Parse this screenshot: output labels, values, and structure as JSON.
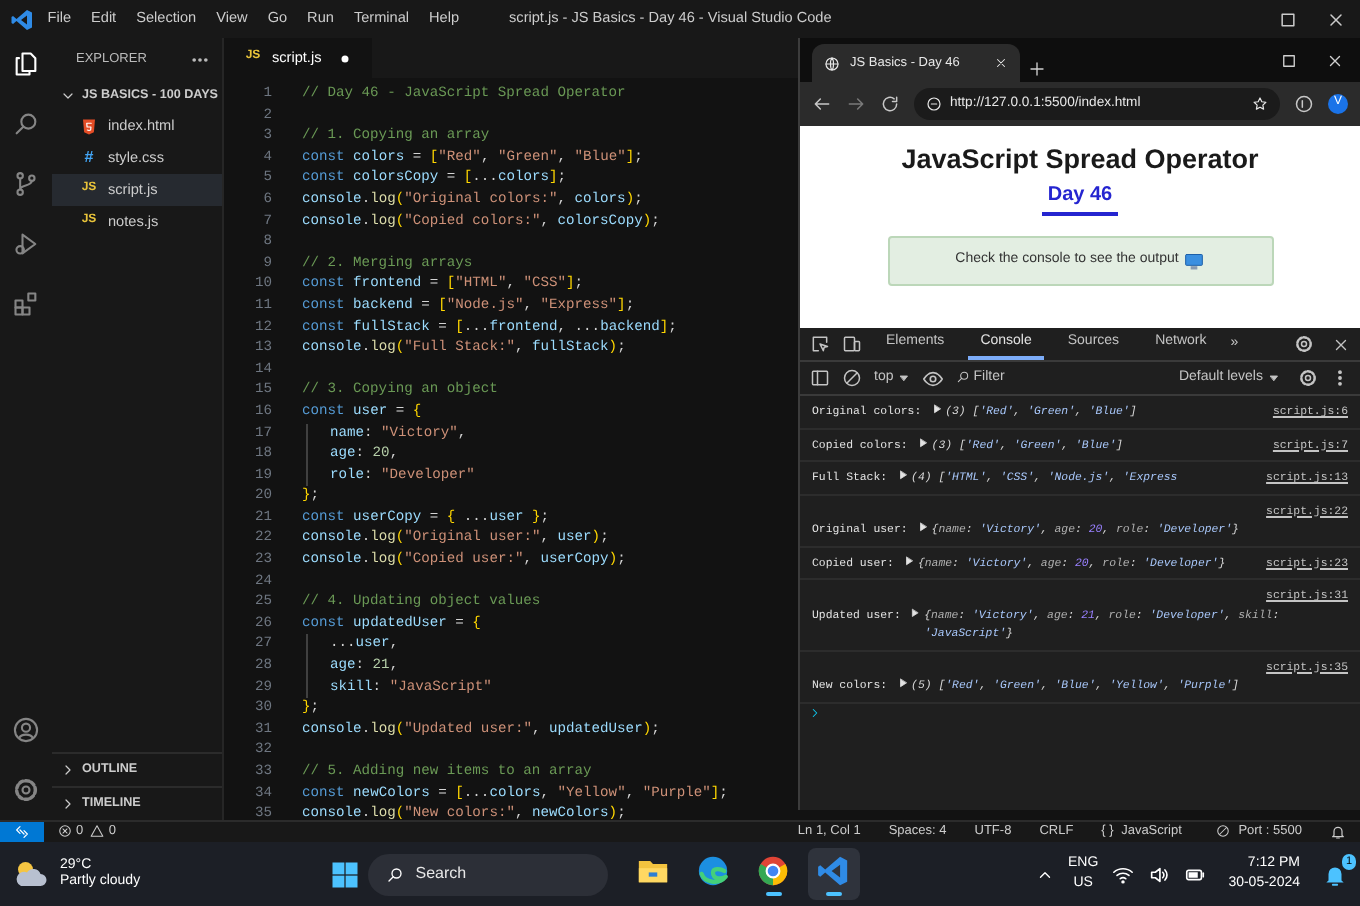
{
  "title_bar": {
    "menu": [
      "File",
      "Edit",
      "Selection",
      "View",
      "Go",
      "Run",
      "Terminal",
      "Help"
    ],
    "title": "script.js - JS Basics - Day 46 - Visual Studio Code"
  },
  "activity_bar": [
    {
      "kind": "files",
      "selected": true
    },
    {
      "kind": "search",
      "selected": false
    },
    {
      "kind": "source-control",
      "selected": false
    },
    {
      "kind": "run",
      "selected": false
    },
    {
      "kind": "extensions",
      "selected": false
    }
  ],
  "sidebar": {
    "header": "EXPLORER",
    "folder": {
      "name": "JS BASICS - 100 DAYS",
      "expanded": true,
      "files": [
        {
          "name": "index.html",
          "kind": "html",
          "selected": false
        },
        {
          "name": "style.css",
          "kind": "css",
          "icon": "#",
          "selected": false
        },
        {
          "name": "script.js",
          "kind": "js",
          "icon": "JS",
          "selected": true
        },
        {
          "name": "notes.js",
          "kind": "js",
          "icon": "JS",
          "selected": false
        }
      ]
    },
    "sections": [
      {
        "name": "OUTLINE",
        "expanded": false
      },
      {
        "name": "TIMELINE",
        "expanded": false
      }
    ]
  },
  "editor": {
    "tabs": [
      {
        "name": "script.js",
        "icon": "JS",
        "selected": true,
        "modified": true
      }
    ],
    "lines": [
      {
        "number": "1",
        "tokens": [
          {
            "kind": "comment",
            "text": "// Day 46 - JavaScript Spread Operator"
          }
        ]
      },
      {
        "number": "2"
      },
      {
        "number": "3",
        "tokens": [
          {
            "kind": "comment",
            "text": "// 1. Copying an array"
          }
        ]
      },
      {
        "number": "4",
        "tokens": [
          {
            "kind": "keyword",
            "text": "const"
          },
          {
            "kind": "variable",
            "text": " colors"
          },
          {
            "kind": "punct",
            "text": " = "
          },
          {
            "kind": "bracket",
            "text": "["
          },
          {
            "kind": "string",
            "text": "\"Red\""
          },
          {
            "kind": "punct",
            "text": ", "
          },
          {
            "kind": "string",
            "text": "\"Green\""
          },
          {
            "kind": "punct",
            "text": ", "
          },
          {
            "kind": "string",
            "text": "\"Blue\""
          },
          {
            "kind": "bracket",
            "text": "]"
          },
          {
            "kind": "punct",
            "text": ";"
          }
        ]
      },
      {
        "number": "5",
        "tokens": [
          {
            "kind": "keyword",
            "text": "const"
          },
          {
            "kind": "variable",
            "text": " colorsCopy"
          },
          {
            "kind": "punct",
            "text": " = "
          },
          {
            "kind": "bracket",
            "text": "["
          },
          {
            "kind": "punct",
            "text": "..."
          },
          {
            "kind": "variable",
            "text": "colors"
          },
          {
            "kind": "bracket",
            "text": "]"
          },
          {
            "kind": "punct",
            "text": ";"
          }
        ]
      },
      {
        "number": "6",
        "tokens": [
          {
            "kind": "variable",
            "text": "console"
          },
          {
            "kind": "punct",
            "text": "."
          },
          {
            "kind": "function",
            "text": "log"
          },
          {
            "kind": "bracket",
            "text": "("
          },
          {
            "kind": "string",
            "text": "\"Original colors:\""
          },
          {
            "kind": "punct",
            "text": ", "
          },
          {
            "kind": "variable",
            "text": "colors"
          },
          {
            "kind": "bracket",
            "text": ")"
          },
          {
            "kind": "punct",
            "text": ";"
          }
        ]
      },
      {
        "number": "7",
        "tokens": [
          {
            "kind": "variable",
            "text": "console"
          },
          {
            "kind": "punct",
            "text": "."
          },
          {
            "kind": "function",
            "text": "log"
          },
          {
            "kind": "bracket",
            "text": "("
          },
          {
            "kind": "string",
            "text": "\"Copied colors:\""
          },
          {
            "kind": "punct",
            "text": ", "
          },
          {
            "kind": "variable",
            "text": "colorsCopy"
          },
          {
            "kind": "bracket",
            "text": ")"
          },
          {
            "kind": "punct",
            "text": ";"
          }
        ]
      },
      {
        "number": "8"
      },
      {
        "number": "9",
        "tokens": [
          {
            "kind": "comment",
            "text": "// 2. Merging arrays"
          }
        ]
      },
      {
        "number": "10",
        "tokens": [
          {
            "kind": "keyword",
            "text": "const"
          },
          {
            "kind": "variable",
            "text": " frontend"
          },
          {
            "kind": "punct",
            "text": " = "
          },
          {
            "kind": "bracket",
            "text": "["
          },
          {
            "kind": "string",
            "text": "\"HTML\""
          },
          {
            "kind": "punct",
            "text": ", "
          },
          {
            "kind": "string",
            "text": "\"CSS\""
          },
          {
            "kind": "bracket",
            "text": "]"
          },
          {
            "kind": "punct",
            "text": ";"
          }
        ]
      },
      {
        "number": "11",
        "tokens": [
          {
            "kind": "keyword",
            "text": "const"
          },
          {
            "kind": "variable",
            "text": " backend"
          },
          {
            "kind": "punct",
            "text": " = "
          },
          {
            "kind": "bracket",
            "text": "["
          },
          {
            "kind": "string",
            "text": "\"Node.js\""
          },
          {
            "kind": "punct",
            "text": ", "
          },
          {
            "kind": "string",
            "text": "\"Express\""
          },
          {
            "kind": "bracket",
            "text": "]"
          },
          {
            "kind": "punct",
            "text": ";"
          }
        ]
      },
      {
        "number": "12",
        "tokens": [
          {
            "kind": "keyword",
            "text": "const"
          },
          {
            "kind": "variable",
            "text": " fullStack"
          },
          {
            "kind": "punct",
            "text": " = "
          },
          {
            "kind": "bracket",
            "text": "["
          },
          {
            "kind": "punct",
            "text": "..."
          },
          {
            "kind": "variable",
            "text": "frontend"
          },
          {
            "kind": "punct",
            "text": ", ..."
          },
          {
            "kind": "variable",
            "text": "backend"
          },
          {
            "kind": "bracket",
            "text": "]"
          },
          {
            "kind": "punct",
            "text": ";"
          }
        ]
      },
      {
        "number": "13",
        "tokens": [
          {
            "kind": "variable",
            "text": "console"
          },
          {
            "kind": "punct",
            "text": "."
          },
          {
            "kind": "function",
            "text": "log"
          },
          {
            "kind": "bracket",
            "text": "("
          },
          {
            "kind": "string",
            "text": "\"Full Stack:\""
          },
          {
            "kind": "punct",
            "text": ", "
          },
          {
            "kind": "variable",
            "text": "fullStack"
          },
          {
            "kind": "bracket",
            "text": ")"
          },
          {
            "kind": "punct",
            "text": ";"
          }
        ]
      },
      {
        "number": "14"
      },
      {
        "number": "15",
        "tokens": [
          {
            "kind": "comment",
            "text": "// 3. Copying an object"
          }
        ]
      },
      {
        "number": "16",
        "tokens": [
          {
            "kind": "keyword",
            "text": "const"
          },
          {
            "kind": "variable",
            "text": " user"
          },
          {
            "kind": "punct",
            "text": " = "
          },
          {
            "kind": "bracket",
            "text": "{"
          }
        ]
      },
      {
        "number": "17",
        "indent": true,
        "tokens": [
          {
            "kind": "property",
            "text": "name"
          },
          {
            "kind": "punct",
            "text": ": "
          },
          {
            "kind": "string",
            "text": "\"Victory\""
          },
          {
            "kind": "punct",
            "text": ","
          }
        ]
      },
      {
        "number": "18",
        "indent": true,
        "tokens": [
          {
            "kind": "property",
            "text": "age"
          },
          {
            "kind": "punct",
            "text": ": "
          },
          {
            "kind": "number",
            "text": "20"
          },
          {
            "kind": "punct",
            "text": ","
          }
        ]
      },
      {
        "number": "19",
        "indent": true,
        "tokens": [
          {
            "kind": "property",
            "text": "role"
          },
          {
            "kind": "punct",
            "text": ": "
          },
          {
            "kind": "string",
            "text": "\"Developer\""
          }
        ]
      },
      {
        "number": "20",
        "tokens": [
          {
            "kind": "bracket",
            "text": "}"
          },
          {
            "kind": "punct",
            "text": ";"
          }
        ]
      },
      {
        "number": "21",
        "tokens": [
          {
            "kind": "keyword",
            "text": "const"
          },
          {
            "kind": "variable",
            "text": " userCopy"
          },
          {
            "kind": "punct",
            "text": " = "
          },
          {
            "kind": "bracket",
            "text": "{"
          },
          {
            "kind": "punct",
            "text": " ..."
          },
          {
            "kind": "variable",
            "text": "user"
          },
          {
            "kind": "bracket",
            "text": " }"
          },
          {
            "kind": "punct",
            "text": ";"
          }
        ]
      },
      {
        "number": "22",
        "tokens": [
          {
            "kind": "variable",
            "text": "console"
          },
          {
            "kind": "punct",
            "text": "."
          },
          {
            "kind": "function",
            "text": "log"
          },
          {
            "kind": "bracket",
            "text": "("
          },
          {
            "kind": "string",
            "text": "\"Original user:\""
          },
          {
            "kind": "punct",
            "text": ", "
          },
          {
            "kind": "variable",
            "text": "user"
          },
          {
            "kind": "bracket",
            "text": ")"
          },
          {
            "kind": "punct",
            "text": ";"
          }
        ]
      },
      {
        "number": "23",
        "tokens": [
          {
            "kind": "variable",
            "text": "console"
          },
          {
            "kind": "punct",
            "text": "."
          },
          {
            "kind": "function",
            "text": "log"
          },
          {
            "kind": "bracket",
            "text": "("
          },
          {
            "kind": "string",
            "text": "\"Copied user:\""
          },
          {
            "kind": "punct",
            "text": ", "
          },
          {
            "kind": "variable",
            "text": "userCopy"
          },
          {
            "kind": "bracket",
            "text": ")"
          },
          {
            "kind": "punct",
            "text": ";"
          }
        ]
      },
      {
        "number": "24"
      },
      {
        "number": "25",
        "tokens": [
          {
            "kind": "comment",
            "text": "// 4. Updating object values"
          }
        ]
      },
      {
        "number": "26",
        "tokens": [
          {
            "kind": "keyword",
            "text": "const"
          },
          {
            "kind": "variable",
            "text": " updatedUser"
          },
          {
            "kind": "punct",
            "text": " = "
          },
          {
            "kind": "bracket",
            "text": "{"
          }
        ]
      },
      {
        "number": "27",
        "indent": true,
        "tokens": [
          {
            "kind": "punct",
            "text": "..."
          },
          {
            "kind": "variable",
            "text": "user"
          },
          {
            "kind": "punct",
            "text": ","
          }
        ]
      },
      {
        "number": "28",
        "indent": true,
        "tokens": [
          {
            "kind": "property",
            "text": "age"
          },
          {
            "kind": "punct",
            "text": ": "
          },
          {
            "kind": "number",
            "text": "21"
          },
          {
            "kind": "punct",
            "text": ","
          }
        ]
      },
      {
        "number": "29",
        "indent": true,
        "tokens": [
          {
            "kind": "property",
            "text": "skill"
          },
          {
            "kind": "punct",
            "text": ": "
          },
          {
            "kind": "string",
            "text": "\"JavaScript\""
          }
        ]
      },
      {
        "number": "30",
        "tokens": [
          {
            "kind": "bracket",
            "text": "}"
          },
          {
            "kind": "punct",
            "text": ";"
          }
        ]
      },
      {
        "number": "31",
        "tokens": [
          {
            "kind": "variable",
            "text": "console"
          },
          {
            "kind": "punct",
            "text": "."
          },
          {
            "kind": "function",
            "text": "log"
          },
          {
            "kind": "bracket",
            "text": "("
          },
          {
            "kind": "string",
            "text": "\"Updated user:\""
          },
          {
            "kind": "punct",
            "text": ", "
          },
          {
            "kind": "variable",
            "text": "updatedUser"
          },
          {
            "kind": "bracket",
            "text": ")"
          },
          {
            "kind": "punct",
            "text": ";"
          }
        ]
      },
      {
        "number": "32"
      },
      {
        "number": "33",
        "tokens": [
          {
            "kind": "comment",
            "text": "// 5. Adding new items to an array"
          }
        ]
      },
      {
        "number": "34",
        "tokens": [
          {
            "kind": "keyword",
            "text": "const"
          },
          {
            "kind": "variable",
            "text": " newColors"
          },
          {
            "kind": "punct",
            "text": " = "
          },
          {
            "kind": "bracket",
            "text": "["
          },
          {
            "kind": "punct",
            "text": "..."
          },
          {
            "kind": "variable",
            "text": "colors"
          },
          {
            "kind": "punct",
            "text": ", "
          },
          {
            "kind": "string",
            "text": "\"Yellow\""
          },
          {
            "kind": "punct",
            "text": ", "
          },
          {
            "kind": "string",
            "text": "\"Purple\""
          },
          {
            "kind": "bracket",
            "text": "]"
          },
          {
            "kind": "punct",
            "text": ";"
          }
        ]
      },
      {
        "number": "35",
        "tokens": [
          {
            "kind": "variable",
            "text": "console"
          },
          {
            "kind": "punct",
            "text": "."
          },
          {
            "kind": "function",
            "text": "log"
          },
          {
            "kind": "bracket",
            "text": "("
          },
          {
            "kind": "string",
            "text": "\"New colors:\""
          },
          {
            "kind": "punct",
            "text": ", "
          },
          {
            "kind": "variable",
            "text": "newColors"
          },
          {
            "kind": "bracket",
            "text": ")"
          },
          {
            "kind": "punct",
            "text": ";"
          }
        ]
      }
    ]
  },
  "browser": {
    "tabs": [
      {
        "title": "JS Basics - Day 46",
        "selected": true
      }
    ],
    "url": "http://127.0.0.1:5500/index.html",
    "profile": "V",
    "page": {
      "heading": "JavaScript Spread Operator",
      "subheading": "Day 46",
      "note": "Check the console to see the output"
    },
    "devtools": {
      "tabs": [
        {
          "label": "Elements",
          "selected": false
        },
        {
          "label": "Console",
          "selected": true
        },
        {
          "label": "Sources",
          "selected": false
        },
        {
          "label": "Network",
          "selected": false
        }
      ],
      "more": "»",
      "context": "top",
      "filter": {
        "placeholder": "Filter"
      },
      "levels": "Default levels",
      "messages": [
        {
          "label": "Original colors:",
          "expanded": false,
          "value": [
            {
              "kind": "punct",
              "text": "(3) ["
            },
            {
              "kind": "string",
              "text": "'Red'"
            },
            {
              "kind": "punct",
              "text": ", "
            },
            {
              "kind": "string",
              "text": "'Green'"
            },
            {
              "kind": "punct",
              "text": ", "
            },
            {
              "kind": "string",
              "text": "'Blue'"
            },
            {
              "kind": "punct",
              "text": "]"
            }
          ],
          "source": "script.js:6"
        },
        {
          "label": "Copied colors:",
          "expanded": false,
          "value": [
            {
              "kind": "punct",
              "text": "(3) ["
            },
            {
              "kind": "string",
              "text": "'Red'"
            },
            {
              "kind": "punct",
              "text": ", "
            },
            {
              "kind": "string",
              "text": "'Green'"
            },
            {
              "kind": "punct",
              "text": ", "
            },
            {
              "kind": "string",
              "text": "'Blue'"
            },
            {
              "kind": "punct",
              "text": "]"
            }
          ],
          "source": "script.js:7"
        },
        {
          "label": "Full Stack:",
          "expanded": false,
          "value": [
            {
              "kind": "punct",
              "text": "(4) ["
            },
            {
              "kind": "string",
              "text": "'HTML'"
            },
            {
              "kind": "punct",
              "text": ", "
            },
            {
              "kind": "string",
              "text": "'CSS'"
            },
            {
              "kind": "punct",
              "text": ", "
            },
            {
              "kind": "string",
              "text": "'Node.js'"
            },
            {
              "kind": "punct",
              "text": ", "
            },
            {
              "kind": "string",
              "text": "'Express"
            }
          ],
          "source": "script.js:13"
        },
        {
          "label": "Original user:",
          "expanded": false,
          "value": [
            {
              "kind": "punct",
              "text": "{"
            },
            {
              "kind": "property",
              "text": "name"
            },
            {
              "kind": "punct",
              "text": ": "
            },
            {
              "kind": "string",
              "text": "'Victory'"
            },
            {
              "kind": "punct",
              "text": ", "
            },
            {
              "kind": "property",
              "text": "age"
            },
            {
              "kind": "punct",
              "text": ": "
            },
            {
              "kind": "number",
              "text": "20"
            },
            {
              "kind": "punct",
              "text": ", "
            },
            {
              "kind": "property",
              "text": "role"
            },
            {
              "kind": "punct",
              "text": ": "
            },
            {
              "kind": "string",
              "text": "'Developer'"
            },
            {
              "kind": "punct",
              "text": "}"
            }
          ],
          "source": "script.js:22"
        },
        {
          "label": "Copied user:",
          "expanded": false,
          "value": [
            {
              "kind": "punct",
              "text": "{"
            },
            {
              "kind": "property",
              "text": "name"
            },
            {
              "kind": "punct",
              "text": ": "
            },
            {
              "kind": "string",
              "text": "'Victory'"
            },
            {
              "kind": "punct",
              "text": ", "
            },
            {
              "kind": "property",
              "text": "age"
            },
            {
              "kind": "punct",
              "text": ": "
            },
            {
              "kind": "number",
              "text": "20"
            },
            {
              "kind": "punct",
              "text": ", "
            },
            {
              "kind": "property",
              "text": "role"
            },
            {
              "kind": "punct",
              "text": ": "
            },
            {
              "kind": "string",
              "text": "'Developer'"
            },
            {
              "kind": "punct",
              "text": "}"
            }
          ],
          "source": "script.js:23"
        },
        {
          "label": "Updated user:",
          "expanded": false,
          "value": [
            {
              "kind": "punct",
              "text": "{"
            },
            {
              "kind": "property",
              "text": "name"
            },
            {
              "kind": "punct",
              "text": ": "
            },
            {
              "kind": "string",
              "text": "'Victory'"
            },
            {
              "kind": "punct",
              "text": ", "
            },
            {
              "kind": "property",
              "text": "age"
            },
            {
              "kind": "punct",
              "text": ": "
            },
            {
              "kind": "number",
              "text": "21"
            },
            {
              "kind": "punct",
              "text": ", "
            },
            {
              "kind": "property",
              "text": "role"
            },
            {
              "kind": "punct",
              "text": ": "
            },
            {
              "kind": "string",
              "text": "'Developer'"
            },
            {
              "kind": "punct",
              "text": ", "
            },
            {
              "kind": "property",
              "text": "skill"
            },
            {
              "kind": "punct",
              "text": ": "
            },
            {
              "kind": "string",
              "text": "'JavaScript'"
            },
            {
              "kind": "punct",
              "text": "}"
            }
          ],
          "source": "script.js:31"
        },
        {
          "label": "New colors:",
          "expanded": false,
          "value": [
            {
              "kind": "punct",
              "text": "(5) ["
            },
            {
              "kind": "string",
              "text": "'Red'"
            },
            {
              "kind": "punct",
              "text": ", "
            },
            {
              "kind": "string",
              "text": "'Green'"
            },
            {
              "kind": "punct",
              "text": ", "
            },
            {
              "kind": "string",
              "text": "'Blue'"
            },
            {
              "kind": "punct",
              "text": ", "
            },
            {
              "kind": "string",
              "text": "'Yellow'"
            },
            {
              "kind": "punct",
              "text": ", "
            },
            {
              "kind": "string",
              "text": "'Purple'"
            },
            {
              "kind": "punct",
              "text": "]"
            }
          ],
          "source": "script.js:35"
        }
      ]
    }
  },
  "status_bar": {
    "errors": "0",
    "warnings": "0",
    "items": [
      "Ln 1, Col 1",
      "Spaces: 4",
      "UTF-8",
      "CRLF"
    ],
    "language": {
      "icon": "{ }",
      "name": "JavaScript"
    },
    "port": "Port : 5500"
  },
  "taskbar": {
    "weather": {
      "temperature": "29°C",
      "condition": "Partly cloudy"
    },
    "search": {
      "placeholder": "Search"
    },
    "apps": [
      {
        "kind": "files",
        "selected": false,
        "running": false
      },
      {
        "kind": "edge",
        "selected": false,
        "running": false
      },
      {
        "kind": "chrome",
        "selected": false,
        "running": true
      },
      {
        "kind": "vscode",
        "selected": true,
        "running": true
      }
    ],
    "language": [
      "ENG",
      "US"
    ],
    "time": "7:12 PM",
    "date": "30-05-2024",
    "notifications": "1"
  }
}
